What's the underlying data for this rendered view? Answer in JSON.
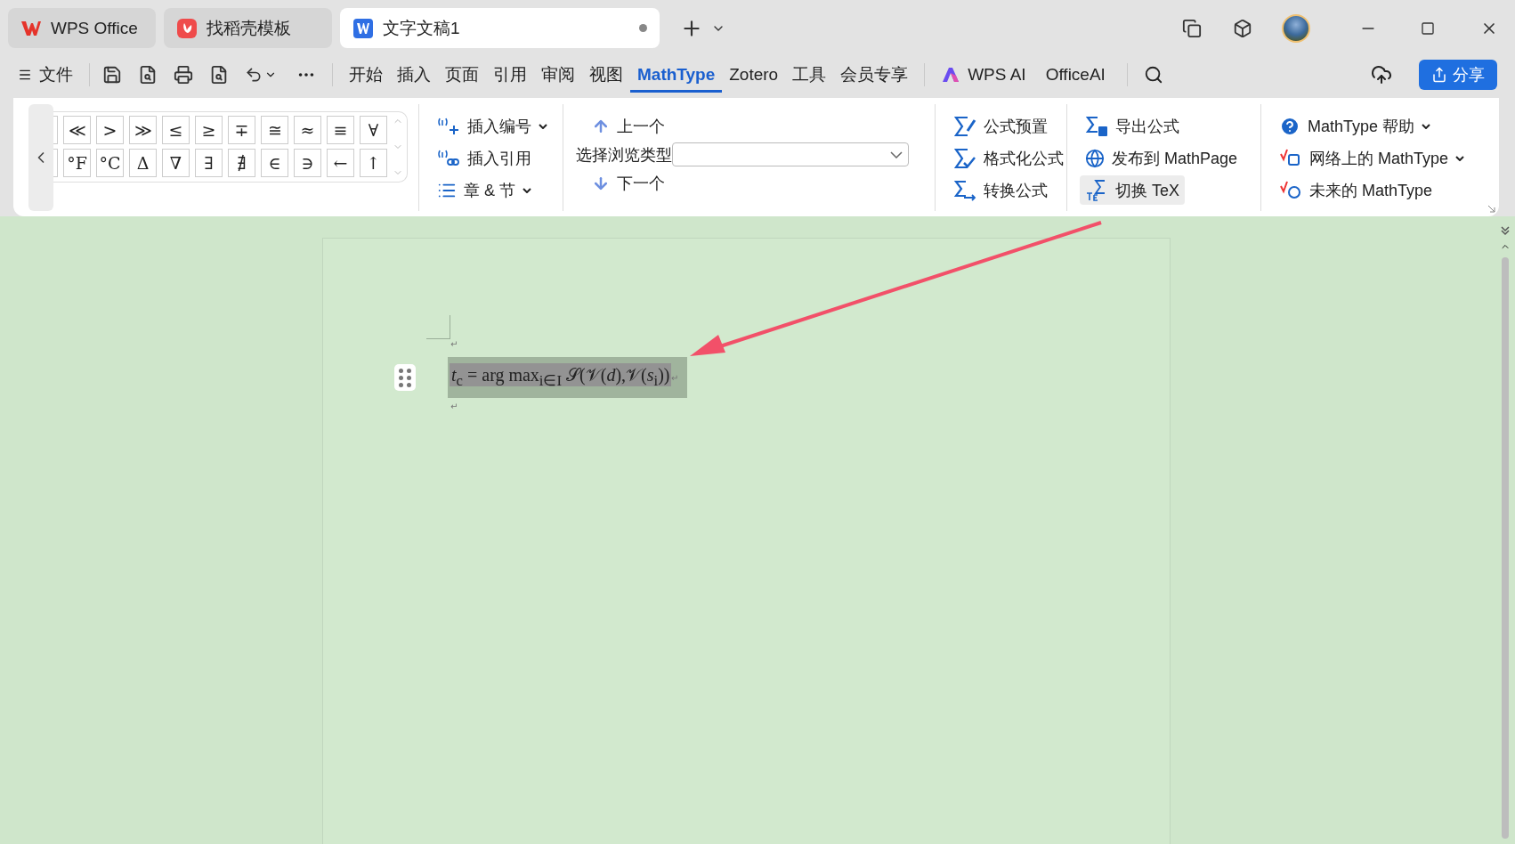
{
  "tabs": [
    {
      "label": "WPS Office",
      "kind": "home",
      "selected": false
    },
    {
      "label": "找稻壳模板",
      "kind": "template",
      "selected": false
    },
    {
      "label": "文字文稿1",
      "kind": "document",
      "selected": true
    }
  ],
  "file_menu": {
    "label": "文件"
  },
  "menu": [
    {
      "label": "开始",
      "selected": false
    },
    {
      "label": "插入",
      "selected": false
    },
    {
      "label": "页面",
      "selected": false
    },
    {
      "label": "引用",
      "selected": false
    },
    {
      "label": "审阅",
      "selected": false
    },
    {
      "label": "视图",
      "selected": false
    },
    {
      "label": "MathType",
      "selected": true
    },
    {
      "label": "Zotero",
      "selected": false
    },
    {
      "label": "工具",
      "selected": false
    },
    {
      "label": "会员专享",
      "selected": false
    }
  ],
  "ai_menu": [
    {
      "label": "WPS AI",
      "kind": "wpsai"
    },
    {
      "label": "OfficeAI",
      "kind": "plain"
    }
  ],
  "share_button": {
    "label": "分享"
  },
  "symbol_palette": {
    "rows": [
      [
        "≪",
        ">",
        "≫",
        "≤",
        "≥",
        "∓",
        "≅",
        "≈",
        "≡",
        "∀"
      ],
      [
        "°F",
        "°C",
        "Δ",
        "∇",
        "∃",
        "∄",
        "∈",
        "∋",
        "←",
        "↑"
      ]
    ]
  },
  "numbering_group": [
    {
      "label": "插入编号",
      "kind": "number",
      "dropdown": true
    },
    {
      "label": "插入引用",
      "kind": "reference",
      "dropdown": false
    },
    {
      "label": "章 & 节",
      "kind": "chapter",
      "dropdown": true
    }
  ],
  "navigation_group": {
    "previous": "上一个",
    "browse_label": "选择浏览类型",
    "next": "下一个"
  },
  "formula_group": [
    {
      "label": "公式预置",
      "kind": "preset"
    },
    {
      "label": "格式化公式",
      "kind": "format"
    },
    {
      "label": "转换公式",
      "kind": "convert"
    }
  ],
  "publish_group": [
    {
      "label": "导出公式",
      "kind": "export",
      "selected": false
    },
    {
      "label": "发布到 MathPage",
      "kind": "globe",
      "selected": false
    },
    {
      "label": "切换 TeX",
      "kind": "tex",
      "selected": true
    }
  ],
  "help_group": [
    {
      "label": "MathType 帮助",
      "kind": "help",
      "dropdown": true
    },
    {
      "label": "网络上的 MathType",
      "kind": "web",
      "dropdown": true
    },
    {
      "label": "未来的 MathType",
      "kind": "future",
      "dropdown": false
    }
  ],
  "document": {
    "paragraph_marks": [
      "↵",
      "↵",
      "↵"
    ],
    "formula": "*t*$_{c}$ = arg max$_{i∈I}$ 𝒮(𝒱(*d*),𝒱(*s*$_{i}$))",
    "formula_selected": true
  }
}
